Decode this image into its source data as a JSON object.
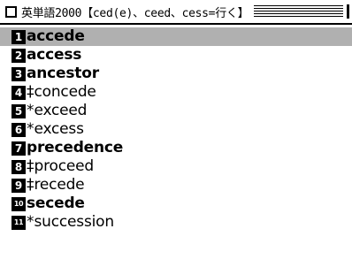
{
  "title": {
    "text": "英単語2000【ced(e)、ceed、cess=行く】"
  },
  "entries": [
    {
      "num": "1",
      "mark": "",
      "word": "accede",
      "bold": true,
      "selected": true
    },
    {
      "num": "2",
      "mark": "",
      "word": "access",
      "bold": true,
      "selected": false
    },
    {
      "num": "3",
      "mark": "",
      "word": "ancestor",
      "bold": true,
      "selected": false
    },
    {
      "num": "4",
      "mark": "‡",
      "word": "concede",
      "bold": false,
      "selected": false
    },
    {
      "num": "5",
      "mark": "*",
      "word": "exceed",
      "bold": false,
      "selected": false
    },
    {
      "num": "6",
      "mark": "*",
      "word": "excess",
      "bold": false,
      "selected": false
    },
    {
      "num": "7",
      "mark": "",
      "word": "precedence",
      "bold": true,
      "selected": false
    },
    {
      "num": "8",
      "mark": "‡",
      "word": "proceed",
      "bold": false,
      "selected": false
    },
    {
      "num": "9",
      "mark": "‡",
      "word": "recede",
      "bold": false,
      "selected": false
    },
    {
      "num": "10",
      "mark": "",
      "word": "secede",
      "bold": true,
      "selected": false
    },
    {
      "num": "11",
      "mark": "*",
      "word": "succession",
      "bold": false,
      "selected": false
    }
  ],
  "colors": {
    "selection": "#b0b0b0",
    "text": "#000000",
    "background": "#ffffff"
  }
}
